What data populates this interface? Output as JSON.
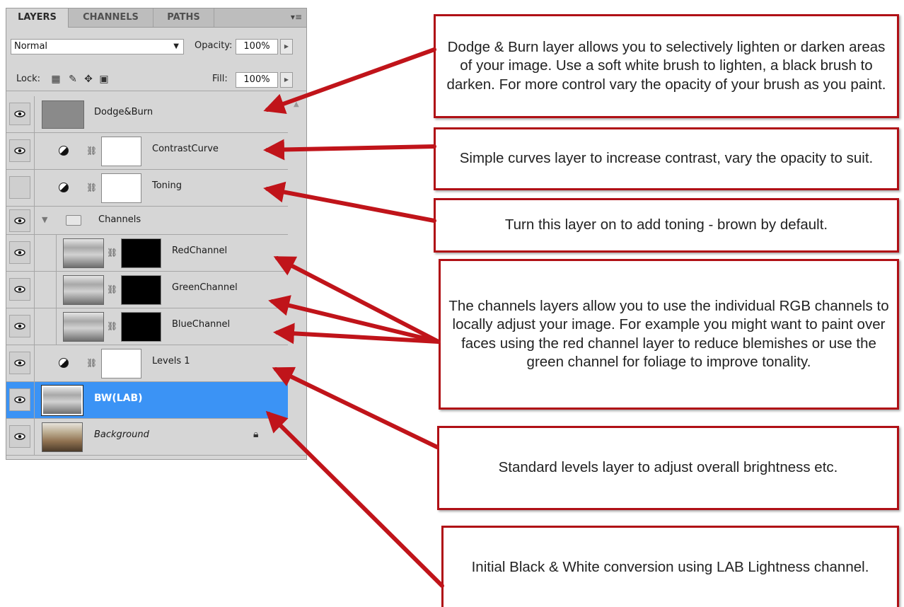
{
  "panel": {
    "tabs": [
      "LAYERS",
      "CHANNELS",
      "PATHS"
    ],
    "menu_icon": "panel-menu-icon",
    "blend_mode": "Normal",
    "opacity_label": "Opacity:",
    "opacity_value": "100%",
    "lock_label": "Lock:",
    "fill_label": "Fill:",
    "fill_value": "100%",
    "layers": [
      {
        "name": "Dodge&Burn",
        "visible": true
      },
      {
        "name": "ContrastCurve",
        "visible": true
      },
      {
        "name": "Toning",
        "visible": false
      },
      {
        "name": "Channels",
        "visible": true
      },
      {
        "name": "RedChannel",
        "visible": true
      },
      {
        "name": "GreenChannel",
        "visible": true
      },
      {
        "name": "BlueChannel",
        "visible": true
      },
      {
        "name": "Levels 1",
        "visible": true
      },
      {
        "name": "BW(LAB)",
        "visible": true,
        "selected": true
      },
      {
        "name": "Background",
        "visible": true,
        "locked": true
      }
    ]
  },
  "callouts": [
    {
      "text": "Dodge & Burn layer allows you to selectively lighten or darken areas of your image. Use a soft white brush to lighten, a black brush to darken. For more control vary the opacity of your brush as you paint."
    },
    {
      "text": "Simple curves layer to increase contrast, vary the opacity to suit."
    },
    {
      "text": "Turn this layer on to add toning - brown by default."
    },
    {
      "text": "The channels layers allow you to use the individual RGB channels to locally adjust your image. For example you might want to paint over faces using the red channel layer to reduce blemishes or use the green channel for foliage to improve tonality."
    },
    {
      "text": "Standard levels layer to adjust overall brightness etc."
    },
    {
      "text": "Initial Black & White conversion using LAB Lightness channel."
    }
  ],
  "colors": {
    "callout_border": "#b01016",
    "arrow": "#c0141a",
    "selected_layer": "#3b93f5",
    "panel_bg": "#d6d6d6"
  }
}
